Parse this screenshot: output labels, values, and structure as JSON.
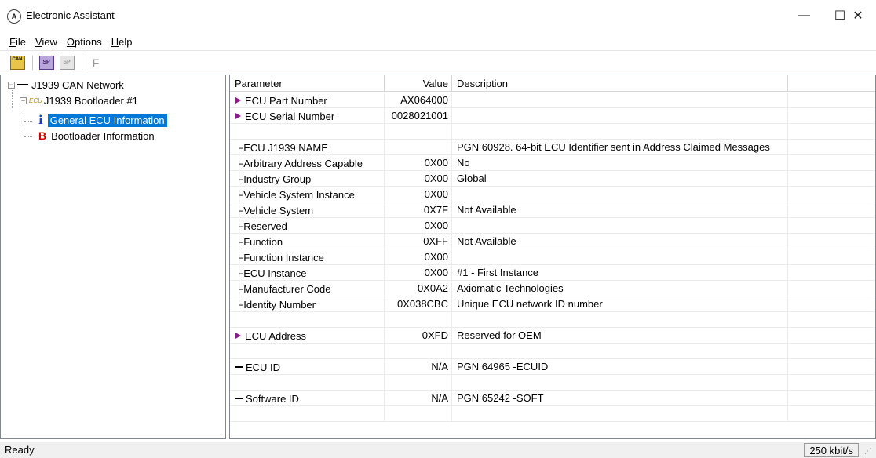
{
  "window": {
    "title": "Electronic Assistant",
    "minimize_glyph": "—",
    "maximize_glyph": "☐",
    "close_glyph": "✕"
  },
  "menu": [
    {
      "underline": "F",
      "rest": "ile"
    },
    {
      "underline": "V",
      "rest": "iew"
    },
    {
      "underline": "O",
      "rest": "ptions"
    },
    {
      "underline": "H",
      "rest": "elp"
    }
  ],
  "toolbar": {
    "can_icon_text": "CAN",
    "sp_icon_text": "SP",
    "f_label": "F"
  },
  "tree": {
    "network": "J1939 CAN Network",
    "bootloader_tag": "ECU",
    "bootloader": "J1939 Bootloader #1",
    "general_icon": "i",
    "general": "General ECU Information",
    "boot_icon": "B",
    "boot_info": "Bootloader Information",
    "expander_glyph": "−"
  },
  "grid": {
    "headers": {
      "parameter": "Parameter",
      "value": "Value",
      "description": "Description"
    },
    "rows": [
      {
        "marker": "bullet",
        "parameter": "ECU Part Number",
        "value": "AX064000",
        "description": ""
      },
      {
        "marker": "bullet",
        "parameter": "ECU Serial Number",
        "value": "0028021001",
        "description": ""
      },
      {
        "marker": "none",
        "parameter": "",
        "value": "",
        "description": ""
      },
      {
        "marker": "top",
        "parameter": "ECU J1939 NAME",
        "value": "",
        "description": "PGN 60928. 64-bit ECU Identifier sent in Address Claimed Messages"
      },
      {
        "marker": "mid",
        "parameter": "Arbitrary Address Capable",
        "value": "0X00",
        "description": "No"
      },
      {
        "marker": "mid",
        "parameter": "Industry Group",
        "value": "0X00",
        "description": "Global"
      },
      {
        "marker": "mid",
        "parameter": "Vehicle System Instance",
        "value": "0X00",
        "description": ""
      },
      {
        "marker": "mid",
        "parameter": "Vehicle System",
        "value": "0X7F",
        "description": "Not Available"
      },
      {
        "marker": "mid",
        "parameter": "Reserved",
        "value": "0X00",
        "description": ""
      },
      {
        "marker": "mid",
        "parameter": "Function",
        "value": "0XFF",
        "description": "Not Available"
      },
      {
        "marker": "mid",
        "parameter": "Function Instance",
        "value": "0X00",
        "description": ""
      },
      {
        "marker": "mid",
        "parameter": "ECU Instance",
        "value": "0X00",
        "description": "#1 - First Instance"
      },
      {
        "marker": "mid",
        "parameter": "Manufacturer Code",
        "value": "0X0A2",
        "description": "Axiomatic Technologies"
      },
      {
        "marker": "end",
        "parameter": "Identity Number",
        "value": "0X038CBC",
        "description": "Unique ECU network ID number"
      },
      {
        "marker": "none",
        "parameter": "",
        "value": "",
        "description": ""
      },
      {
        "marker": "bullet",
        "parameter": "ECU Address",
        "value": "0XFD",
        "description": "Reserved for OEM"
      },
      {
        "marker": "none",
        "parameter": "",
        "value": "",
        "description": ""
      },
      {
        "marker": "dash",
        "parameter": "ECU ID",
        "value": "N/A",
        "description": "PGN 64965  -ECUID"
      },
      {
        "marker": "none",
        "parameter": "",
        "value": "",
        "description": ""
      },
      {
        "marker": "dash",
        "parameter": "Software ID",
        "value": "N/A",
        "description": "PGN 65242  -SOFT"
      },
      {
        "marker": "none",
        "parameter": "",
        "value": "",
        "description": ""
      }
    ]
  },
  "status": {
    "text": "Ready",
    "baud": "250 kbit/s"
  }
}
